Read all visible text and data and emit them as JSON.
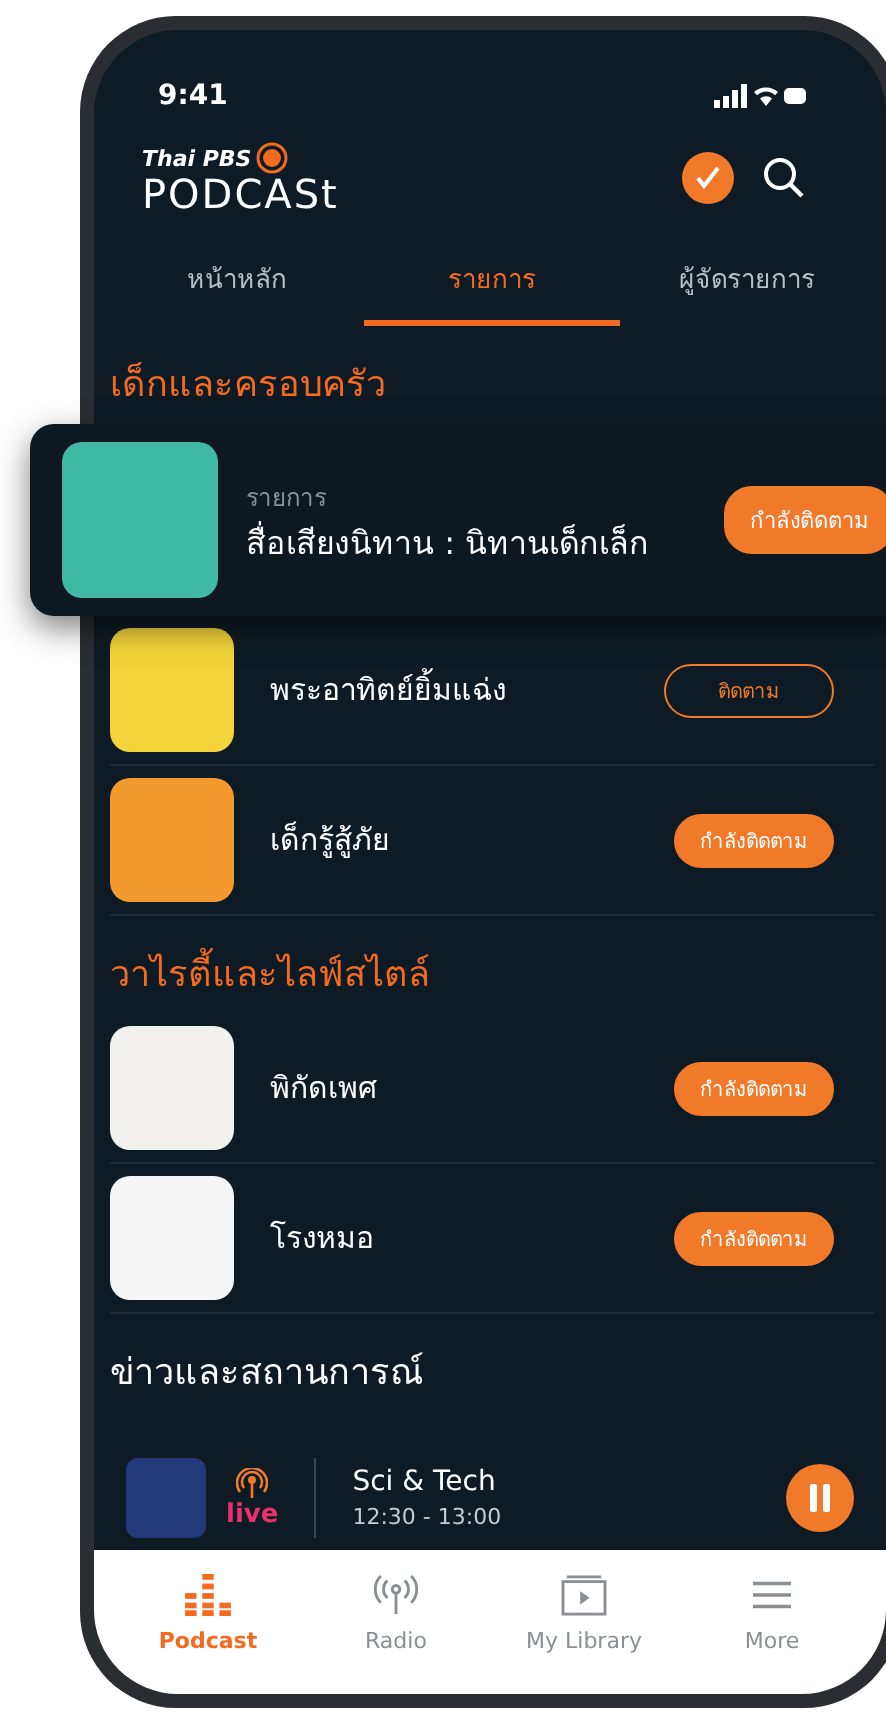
{
  "status_bar": {
    "time": "9:41"
  },
  "header": {
    "brand": "Thai PBS",
    "name": "PODCASt"
  },
  "tabs": [
    {
      "label": "หน้าหลัก",
      "selected": false
    },
    {
      "label": "รายการ",
      "selected": true
    },
    {
      "label": "ผู้จัดรายการ",
      "selected": false
    }
  ],
  "sections": [
    {
      "title": "เด็กและครอบครัว",
      "title_accent": true,
      "items": [
        {
          "featured": true,
          "category": "รายการ",
          "title": "สื่อเสียงนิทาน : นิทานเด็กเล็ก",
          "following": true,
          "button": "กำลังติดตาม",
          "color": "#3fb8a6"
        },
        {
          "featured": false,
          "title": "พระอาทิตย์ยิ้มแฉ่ง",
          "following": false,
          "button": "ติดตาม",
          "color": "#f4d43a"
        },
        {
          "featured": false,
          "title": "เด็กรู้สู้ภัย",
          "following": true,
          "button": "กำลังติดตาม",
          "color": "#f29a2e"
        }
      ]
    },
    {
      "title": "วาไรตี้และไลฟ์สไตล์",
      "title_accent": true,
      "items": [
        {
          "featured": false,
          "title": "พิกัดเพศ",
          "following": true,
          "button": "กำลังติดตาม",
          "color": "#f3f1ee"
        },
        {
          "featured": false,
          "title": "โรงหมอ",
          "following": true,
          "button": "กำลังติดตาม",
          "color": "#f5f5f5"
        }
      ]
    },
    {
      "title": "ข่าวและสถานการณ์",
      "title_accent": false
    }
  ],
  "now_playing": {
    "live": "live",
    "title": "Sci & Tech",
    "time": "12:30 - 13:00",
    "playing": true
  },
  "nav": [
    {
      "kind": "podcast",
      "label": "Podcast",
      "selected": true
    },
    {
      "kind": "radio",
      "label": "Radio",
      "selected": false
    },
    {
      "kind": "library",
      "label": "My Library",
      "selected": false
    },
    {
      "kind": "more",
      "label": "More",
      "selected": false
    }
  ]
}
